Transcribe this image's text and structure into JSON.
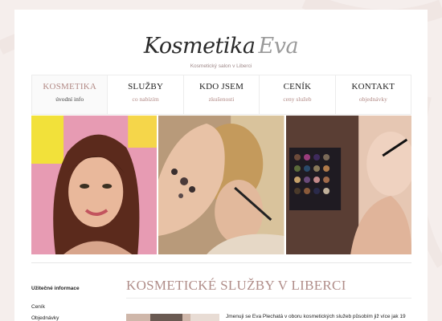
{
  "header": {
    "logo_main": "Kosmetika",
    "logo_accent": "Eva",
    "tagline": "Kosmetický salon v Liberci"
  },
  "nav": {
    "items": [
      {
        "title": "KOSMETIKA",
        "subtitle": "úvodní info"
      },
      {
        "title": "SLUŽBY",
        "subtitle": "co nabízím"
      },
      {
        "title": "KDO JSEM",
        "subtitle": "zkušenosti"
      },
      {
        "title": "CENÍK",
        "subtitle": "ceny služeb"
      },
      {
        "title": "KONTAKT",
        "subtitle": "objednávky"
      }
    ]
  },
  "sidebar": {
    "title": "Užitečné informace",
    "links": [
      "Ceník",
      "Objednávky"
    ]
  },
  "main": {
    "heading": "KOSMETICKÉ SLUŽBY V LIBERCI",
    "intro": "Jmenuji se Eva Plechatá v oboru kosmetických služeb působím již více jak 19"
  },
  "colors": {
    "accent": "#b08d89",
    "background": "#f5eeec"
  }
}
